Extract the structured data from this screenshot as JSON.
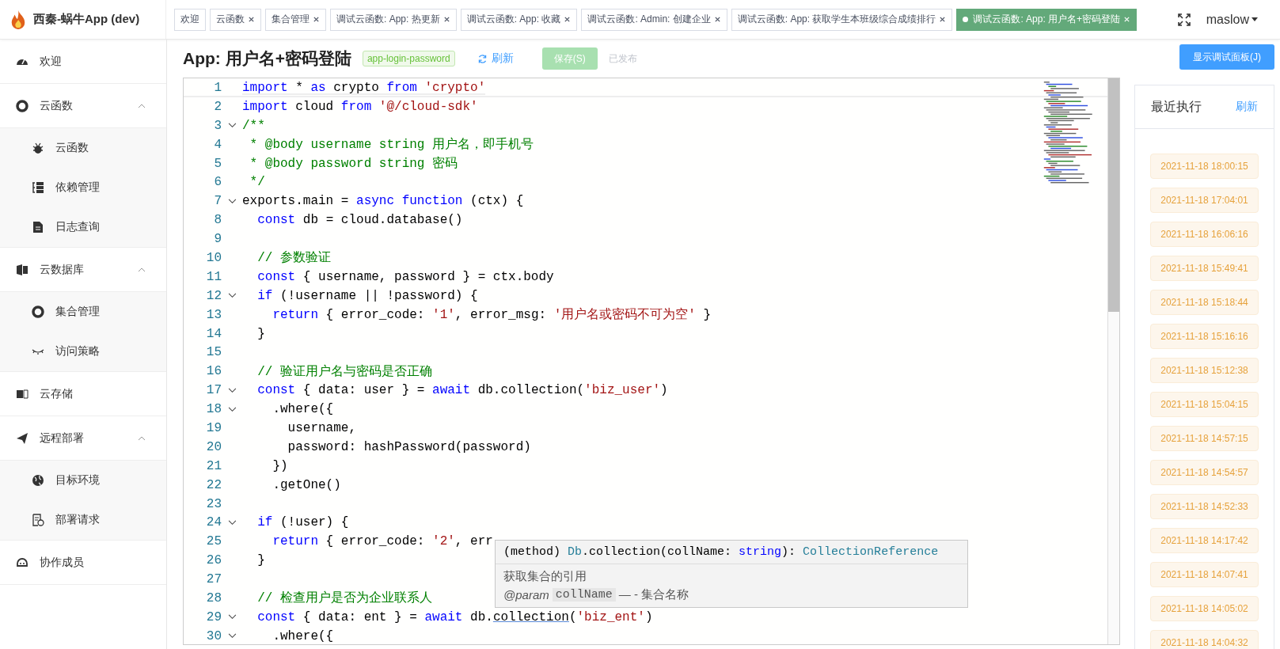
{
  "app": {
    "title": "西秦-蜗牛App (dev)"
  },
  "tabs": [
    {
      "label": "欢迎",
      "selected": false,
      "closable": false
    },
    {
      "label": "云函数",
      "selected": false,
      "closable": true
    },
    {
      "label": "集合管理",
      "selected": false,
      "closable": true
    },
    {
      "label": "调试云函数: App: 热更新",
      "selected": false,
      "closable": true
    },
    {
      "label": "调试云函数: App: 收藏",
      "selected": false,
      "closable": true
    },
    {
      "label": "调试云函数: Admin: 创建企业",
      "selected": false,
      "closable": true
    },
    {
      "label": "调试云函数: App: 获取学生本班级综合成绩排行",
      "selected": false,
      "closable": true
    },
    {
      "label": "调试云函数: App: 用户名+密码登陆",
      "selected": true,
      "closable": true
    }
  ],
  "user": {
    "name": "maslow"
  },
  "sidebar": {
    "items": [
      {
        "label": "欢迎"
      },
      {
        "label": "云函数",
        "expanded": true,
        "children": [
          {
            "label": "云函数"
          },
          {
            "label": "依赖管理"
          },
          {
            "label": "日志查询"
          }
        ]
      },
      {
        "label": "云数据库",
        "expanded": true,
        "children": [
          {
            "label": "集合管理"
          },
          {
            "label": "访问策略"
          }
        ]
      },
      {
        "label": "云存储"
      },
      {
        "label": "远程部署",
        "expanded": true,
        "children": [
          {
            "label": "目标环境"
          },
          {
            "label": "部署请求"
          }
        ]
      },
      {
        "label": "协作成员"
      }
    ]
  },
  "header": {
    "title": "App: 用户名+密码登陆",
    "tag": "app-login-password",
    "refresh": "刷新",
    "save": {
      "label": "保存(S)",
      "disabled": true
    },
    "status": "已发布"
  },
  "editor": {
    "lines": [
      {
        "number": "1",
        "fold": false,
        "current": true,
        "tokens": [
          {
            "kind": "kw",
            "text": "import"
          },
          {
            "kind": "plain",
            "text": " * "
          },
          {
            "kind": "kw",
            "text": "as"
          },
          {
            "kind": "plain",
            "text": " crypto "
          },
          {
            "kind": "kw",
            "text": "from "
          },
          {
            "kind": "str",
            "text": "'crypto'"
          }
        ]
      },
      {
        "number": "2",
        "fold": false,
        "current": false,
        "tokens": [
          {
            "kind": "kw",
            "text": "import"
          },
          {
            "kind": "plain",
            "text": " cloud "
          },
          {
            "kind": "kw",
            "text": "from "
          },
          {
            "kind": "str",
            "text": "'@/cloud-sdk'"
          }
        ]
      },
      {
        "number": "3",
        "fold": true,
        "current": false,
        "tokens": [
          {
            "kind": "cm",
            "text": "/**"
          }
        ]
      },
      {
        "number": "4",
        "fold": false,
        "current": false,
        "tokens": [
          {
            "kind": "cm",
            "text": " * @body username string 用户名，即手机号"
          }
        ]
      },
      {
        "number": "5",
        "fold": false,
        "current": false,
        "tokens": [
          {
            "kind": "cm",
            "text": " * @body password string 密码"
          }
        ]
      },
      {
        "number": "6",
        "fold": false,
        "current": false,
        "tokens": [
          {
            "kind": "cm",
            "text": " */"
          }
        ]
      },
      {
        "number": "7",
        "fold": true,
        "current": false,
        "tokens": [
          {
            "kind": "plain",
            "text": "exports.main = "
          },
          {
            "kind": "kw",
            "text": "async function"
          },
          {
            "kind": "plain",
            "text": " (ctx) {"
          }
        ]
      },
      {
        "number": "8",
        "fold": false,
        "current": false,
        "tokens": [
          {
            "kind": "kw",
            "text": "  const"
          },
          {
            "kind": "plain",
            "text": " db = cloud.database()"
          }
        ]
      },
      {
        "number": "9",
        "fold": false,
        "current": false
      },
      {
        "number": "10",
        "fold": false,
        "current": false,
        "tokens": [
          {
            "kind": "cm",
            "text": "  // 参数验证"
          }
        ]
      },
      {
        "number": "11",
        "fold": false,
        "current": false,
        "tokens": [
          {
            "kind": "kw",
            "text": "  const"
          },
          {
            "kind": "plain",
            "text": " { username, password } = ctx.body"
          }
        ]
      },
      {
        "number": "12",
        "fold": true,
        "current": false,
        "tokens": [
          {
            "kind": "kw",
            "text": "  if"
          },
          {
            "kind": "plain",
            "text": " (!username || !password) {"
          }
        ]
      },
      {
        "number": "13",
        "fold": false,
        "current": false,
        "tokens": [
          {
            "kind": "kw",
            "text": "    return"
          },
          {
            "kind": "plain",
            "text": " { error_code: "
          },
          {
            "kind": "str",
            "text": "'1'"
          },
          {
            "kind": "plain",
            "text": ", error_msg: "
          },
          {
            "kind": "str",
            "text": "'用户名或密码不可为空'"
          },
          {
            "kind": "plain",
            "text": " }"
          }
        ]
      },
      {
        "number": "14",
        "fold": false,
        "current": false,
        "tokens": [
          {
            "kind": "plain",
            "text": "  }"
          }
        ]
      },
      {
        "number": "15",
        "fold": false,
        "current": false
      },
      {
        "number": "16",
        "fold": false,
        "current": false,
        "tokens": [
          {
            "kind": "cm",
            "text": "  // 验证用户名与密码是否正确"
          }
        ]
      },
      {
        "number": "17",
        "fold": true,
        "current": false,
        "tokens": [
          {
            "kind": "kw",
            "text": "  const"
          },
          {
            "kind": "plain",
            "text": " { data: user } = "
          },
          {
            "kind": "kw",
            "text": "await"
          },
          {
            "kind": "plain",
            "text": " db.collection("
          },
          {
            "kind": "str",
            "text": "'biz_user'"
          },
          {
            "kind": "plain",
            "text": ")"
          }
        ]
      },
      {
        "number": "18",
        "fold": true,
        "current": false,
        "tokens": [
          {
            "kind": "plain",
            "text": "    .where({"
          }
        ]
      },
      {
        "number": "19",
        "fold": false,
        "current": false,
        "tokens": [
          {
            "kind": "plain",
            "text": "      username,"
          }
        ]
      },
      {
        "number": "20",
        "fold": false,
        "current": false,
        "tokens": [
          {
            "kind": "plain",
            "text": "      password: hashPassword(password)"
          }
        ]
      },
      {
        "number": "21",
        "fold": false,
        "current": false,
        "tokens": [
          {
            "kind": "plain",
            "text": "    })"
          }
        ]
      },
      {
        "number": "22",
        "fold": false,
        "current": false,
        "tokens": [
          {
            "kind": "plain",
            "text": "    .getOne()"
          }
        ]
      },
      {
        "number": "23",
        "fold": false,
        "current": false
      },
      {
        "number": "24",
        "fold": true,
        "current": false,
        "tokens": [
          {
            "kind": "kw",
            "text": "  if"
          },
          {
            "kind": "plain",
            "text": " (!user) {"
          }
        ]
      },
      {
        "number": "25",
        "fold": false,
        "current": false,
        "tokens": [
          {
            "kind": "kw",
            "text": "    return"
          },
          {
            "kind": "plain",
            "text": " { error_code: "
          },
          {
            "kind": "str",
            "text": "'2'"
          },
          {
            "kind": "plain",
            "text": ", err"
          }
        ]
      },
      {
        "number": "26",
        "fold": false,
        "current": false,
        "tokens": [
          {
            "kind": "plain",
            "text": "  }"
          }
        ]
      },
      {
        "number": "27",
        "fold": false,
        "current": false
      },
      {
        "number": "28",
        "fold": false,
        "current": false,
        "tokens": [
          {
            "kind": "cm",
            "text": "  // 检查用户是否为企业联系人"
          }
        ]
      },
      {
        "number": "29",
        "fold": true,
        "current": false,
        "tokens": [
          {
            "kind": "kw",
            "text": "  const"
          },
          {
            "kind": "plain",
            "text": " { data: ent } = "
          },
          {
            "kind": "kw",
            "text": "await"
          },
          {
            "kind": "plain",
            "text": " db."
          },
          {
            "kind": "hover",
            "text": "collection"
          },
          {
            "kind": "plain",
            "text": "("
          },
          {
            "kind": "str",
            "text": "'biz_ent'"
          },
          {
            "kind": "plain",
            "text": ")"
          }
        ]
      },
      {
        "number": "30",
        "fold": true,
        "current": false,
        "tokens": [
          {
            "kind": "plain",
            "text": "    .where({"
          }
        ]
      }
    ],
    "tooltip": {
      "signature": [
        {
          "kind": "plain",
          "text": "(method) "
        },
        {
          "kind": "type",
          "text": "Db"
        },
        {
          "kind": "plain",
          "text": ".collection(collName: "
        },
        {
          "kind": "kw",
          "text": "string"
        },
        {
          "kind": "plain",
          "text": "): "
        },
        {
          "kind": "type",
          "text": "CollectionReference"
        }
      ],
      "description": "获取集合的引用",
      "param_tag": "@param",
      "param_name": "collName",
      "param_text": "— - 集合名称"
    }
  },
  "debug_button": "显示调试面板(J)",
  "recent": {
    "title": "最近执行",
    "refresh": "刷新",
    "runs": [
      "2021-11-18 18:00:15",
      "2021-11-18 17:04:01",
      "2021-11-18 16:06:16",
      "2021-11-18 15:49:41",
      "2021-11-18 15:18:44",
      "2021-11-18 15:16:16",
      "2021-11-18 15:12:38",
      "2021-11-18 15:04:15",
      "2021-11-18 14:57:15",
      "2021-11-18 14:54:57",
      "2021-11-18 14:52:33",
      "2021-11-18 14:17:42",
      "2021-11-18 14:07:41",
      "2021-11-18 14:05:02",
      "2021-11-18 14:04:32"
    ]
  }
}
